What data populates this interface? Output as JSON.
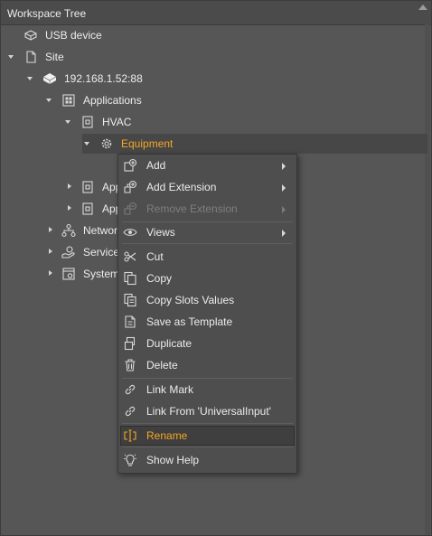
{
  "panel": {
    "title": "Workspace Tree"
  },
  "tree": {
    "usb_device": "USB device",
    "site": "Site",
    "ip": "192.168.1.52:88",
    "applications": "Applications",
    "hvac": "HVAC",
    "equipment": "Equipment",
    "app1": "App",
    "app2": "App",
    "networks": "Networ",
    "services": "Services",
    "system": "System"
  },
  "menu": {
    "add": "Add",
    "add_extension": "Add Extension",
    "remove_extension": "Remove Extension",
    "views": "Views",
    "cut": "Cut",
    "copy": "Copy",
    "copy_slots_values": "Copy Slots Values",
    "save_as_template": "Save as Template",
    "duplicate": "Duplicate",
    "delete": "Delete",
    "link_mark": "Link Mark",
    "link_from": "Link From 'UniversalInput'",
    "rename": "Rename",
    "show_help": "Show Help"
  },
  "colors": {
    "accent": "#f5a623",
    "background": "#565656",
    "menu_background": "#4e4e4e"
  }
}
